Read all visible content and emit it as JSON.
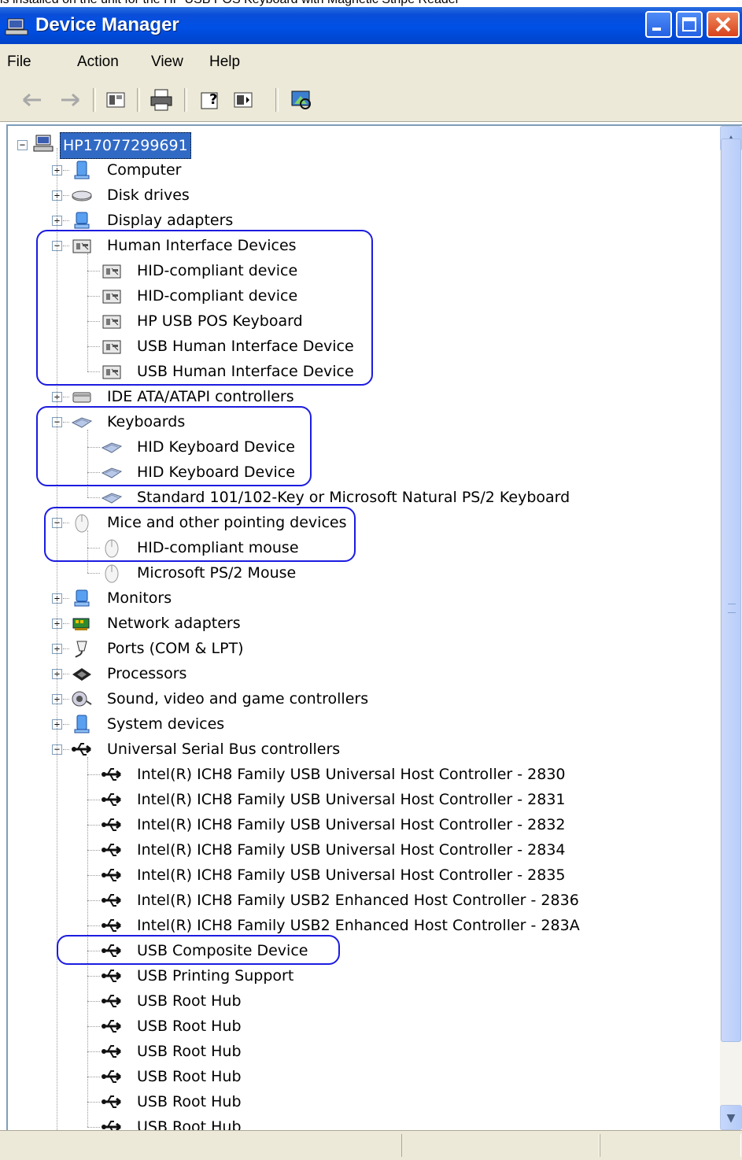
{
  "caption": "ls installed on the unit for the HP USB POS Keyboard with Magnetic Stripe Reader",
  "window": {
    "title": "Device Manager",
    "controls": {
      "minimize": "minimize",
      "maximize": "maximize",
      "close": "close"
    }
  },
  "menu": [
    {
      "label": "File",
      "access_key": "F"
    },
    {
      "label": "Action",
      "access_key": "A"
    },
    {
      "label": "View",
      "access_key": "V"
    },
    {
      "label": "Help",
      "access_key": "H"
    }
  ],
  "toolbar": [
    {
      "name": "back-icon"
    },
    {
      "name": "forward-icon"
    },
    {
      "name": "properties-icon"
    },
    {
      "name": "print-icon"
    },
    {
      "name": "help-icon"
    },
    {
      "name": "show-hide-console-tree-icon"
    },
    {
      "name": "scan-hardware-icon"
    }
  ],
  "tree": {
    "root": "HP17077299691",
    "items": [
      {
        "label": "Computer",
        "level": 1,
        "expander": "+",
        "icon": "computer-icon"
      },
      {
        "label": "Disk drives",
        "level": 1,
        "expander": "+",
        "icon": "disk-drive-icon"
      },
      {
        "label": "Display adapters",
        "level": 1,
        "expander": "+",
        "icon": "display-adapter-icon"
      },
      {
        "label": "Human Interface Devices",
        "level": 1,
        "expander": "-",
        "icon": "hid-icon"
      },
      {
        "label": "HID-compliant device",
        "level": 2,
        "icon": "hid-icon"
      },
      {
        "label": "HID-compliant device",
        "level": 2,
        "icon": "hid-icon"
      },
      {
        "label": "HP USB POS Keyboard",
        "level": 2,
        "icon": "hid-icon"
      },
      {
        "label": "USB Human Interface Device",
        "level": 2,
        "icon": "hid-icon"
      },
      {
        "label": "USB Human Interface Device",
        "level": 2,
        "icon": "hid-icon"
      },
      {
        "label": "IDE ATA/ATAPI controllers",
        "level": 1,
        "expander": "+",
        "icon": "ide-controller-icon"
      },
      {
        "label": "Keyboards",
        "level": 1,
        "expander": "-",
        "icon": "keyboard-icon"
      },
      {
        "label": "HID Keyboard Device",
        "level": 2,
        "icon": "keyboard-icon"
      },
      {
        "label": "HID Keyboard Device",
        "level": 2,
        "icon": "keyboard-icon"
      },
      {
        "label": "Standard 101/102-Key or Microsoft Natural PS/2 Keyboard",
        "level": 2,
        "icon": "keyboard-icon"
      },
      {
        "label": "Mice and other pointing devices",
        "level": 1,
        "expander": "-",
        "icon": "mouse-icon"
      },
      {
        "label": "HID-compliant mouse",
        "level": 2,
        "icon": "mouse-icon"
      },
      {
        "label": "Microsoft PS/2 Mouse",
        "level": 2,
        "icon": "mouse-icon"
      },
      {
        "label": "Monitors",
        "level": 1,
        "expander": "+",
        "icon": "monitor-icon"
      },
      {
        "label": "Network adapters",
        "level": 1,
        "expander": "+",
        "icon": "network-adapter-icon"
      },
      {
        "label": "Ports (COM & LPT)",
        "level": 1,
        "expander": "+",
        "icon": "port-icon"
      },
      {
        "label": "Processors",
        "level": 1,
        "expander": "+",
        "icon": "processor-icon"
      },
      {
        "label": "Sound, video and game controllers",
        "level": 1,
        "expander": "+",
        "icon": "sound-icon"
      },
      {
        "label": "System devices",
        "level": 1,
        "expander": "+",
        "icon": "system-device-icon"
      },
      {
        "label": "Universal Serial Bus controllers",
        "level": 1,
        "expander": "-",
        "icon": "usb-icon"
      },
      {
        "label": "Intel(R) ICH8 Family USB Universal Host Controller - 2830",
        "level": 2,
        "icon": "usb-icon"
      },
      {
        "label": "Intel(R) ICH8 Family USB Universal Host Controller - 2831",
        "level": 2,
        "icon": "usb-icon"
      },
      {
        "label": "Intel(R) ICH8 Family USB Universal Host Controller - 2832",
        "level": 2,
        "icon": "usb-icon"
      },
      {
        "label": "Intel(R) ICH8 Family USB Universal Host Controller - 2834",
        "level": 2,
        "icon": "usb-icon"
      },
      {
        "label": "Intel(R) ICH8 Family USB Universal Host Controller - 2835",
        "level": 2,
        "icon": "usb-icon"
      },
      {
        "label": "Intel(R) ICH8 Family USB2 Enhanced Host Controller - 2836",
        "level": 2,
        "icon": "usb-icon"
      },
      {
        "label": "Intel(R) ICH8 Family USB2 Enhanced Host Controller - 283A",
        "level": 2,
        "icon": "usb-icon"
      },
      {
        "label": "USB Composite Device",
        "level": 2,
        "icon": "usb-icon"
      },
      {
        "label": "USB Printing Support",
        "level": 2,
        "icon": "usb-icon"
      },
      {
        "label": "USB Root Hub",
        "level": 2,
        "icon": "usb-icon"
      },
      {
        "label": "USB Root Hub",
        "level": 2,
        "icon": "usb-icon"
      },
      {
        "label": "USB Root Hub",
        "level": 2,
        "icon": "usb-icon"
      },
      {
        "label": "USB Root Hub",
        "level": 2,
        "icon": "usb-icon"
      },
      {
        "label": "USB Root Hub",
        "level": 2,
        "icon": "usb-icon"
      },
      {
        "label": "USB Root Hub",
        "level": 2,
        "icon": "usb-icon"
      }
    ]
  },
  "annotations": [
    {
      "name": "highlight-human-interface-devices",
      "from": 3,
      "to": 8
    },
    {
      "name": "highlight-keyboards",
      "from": 10,
      "to": 12
    },
    {
      "name": "highlight-mice",
      "from": 14,
      "to": 15
    },
    {
      "name": "highlight-usb-composite-device",
      "from": 31,
      "to": 31
    }
  ],
  "colors": {
    "titlebar": "#0050e6",
    "selection": "#316ac5",
    "annotation": "#1c1ce0",
    "chrome": "#ece9d8"
  }
}
